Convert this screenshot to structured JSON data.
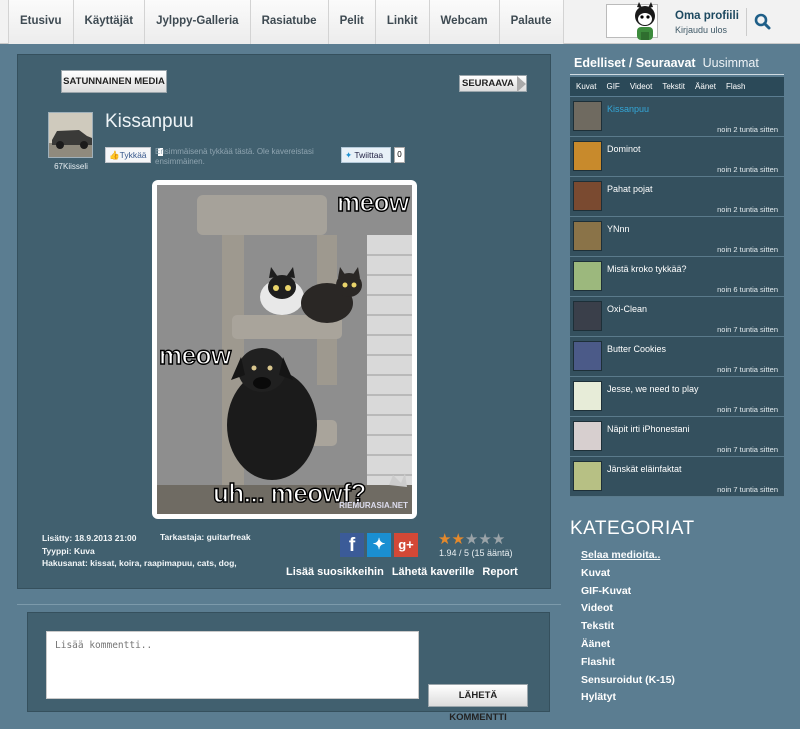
{
  "nav": {
    "tabs": [
      "Etusivu",
      "Käyttäjät",
      "Jylppy-Galleria",
      "Rasiatube",
      "Pelit",
      "Linkit",
      "Webcam",
      "Palaute"
    ]
  },
  "profile": {
    "name": "Oma profiili",
    "logout": "Kirjaudu ulos",
    "search_icon": "search-icon"
  },
  "media": {
    "random_button": "SATUNNAINEN MEDIA",
    "next_button": "SEURAAVA",
    "title": "Kissanpuu",
    "uploader": "67Kiisseli",
    "like_button": "Tykkää",
    "like_text": "Ensimmäisenä tykkää tästä. Ole kavereistasi ensimmäinen.",
    "tweet_button": "Twiittaa",
    "tweet_count": "0",
    "meme_text": {
      "top": "meow",
      "middle": "meow",
      "bottom": "uh... meowf?",
      "watermark": "RIEMURASIA.NET"
    },
    "added": "Lisätty: 18.9.2013 21:00",
    "reviewer": "Tarkastaja: guitarfreak",
    "type": "Tyyppi: Kuva",
    "tags": "Hakusanat: kissat, koira, raapimapuu, cats, dog,",
    "rating": {
      "value": 1.94,
      "max": 5,
      "text": "1.94 / 5 (15 ääntä)"
    },
    "actions": [
      "Lisää suosikkeihin",
      "Lähetä kaverille",
      "Report"
    ],
    "share_icons": [
      "facebook-icon",
      "twitter-icon",
      "googleplus-icon"
    ]
  },
  "comment": {
    "placeholder": "Lisää kommentti..",
    "send_button": "LÄHETÄ KOMMENTTI"
  },
  "sidebar": {
    "tabs_active": "Edelliset / Seuraavat",
    "tab_new": "Uusimmat",
    "types": [
      "Kuvat",
      "GIF",
      "Videot",
      "Tekstit",
      "Äänet",
      "Flash"
    ],
    "items": [
      {
        "title": "Kissanpuu",
        "time": "noin 2 tuntia sitten",
        "active": true,
        "color": "#6f6a60"
      },
      {
        "title": "Dominot",
        "time": "noin 2 tuntia sitten",
        "active": false,
        "color": "#c88a2c"
      },
      {
        "title": "Pahat pojat",
        "time": "noin 2 tuntia sitten",
        "active": false,
        "color": "#7a4a30"
      },
      {
        "title": "YNnn",
        "time": "noin 2 tuntia sitten",
        "active": false,
        "color": "#8a7348"
      },
      {
        "title": "Mistä kroko tykkää?",
        "time": "noin 6 tuntia sitten",
        "active": false,
        "color": "#9cb87d"
      },
      {
        "title": "Oxi-Clean",
        "time": "noin 7 tuntia sitten",
        "active": false,
        "color": "#3a3f4a"
      },
      {
        "title": "Butter Cookies",
        "time": "noin 7 tuntia sitten",
        "active": false,
        "color": "#4b5a88"
      },
      {
        "title": "Jesse, we need to play",
        "time": "noin 7 tuntia sitten",
        "active": false,
        "color": "#e7ecd8"
      },
      {
        "title": "Näpit irti iPhonestani",
        "time": "noin 7 tuntia sitten",
        "active": false,
        "color": "#d7cfcf"
      },
      {
        "title": "Jänskät eläinfaktat",
        "time": "noin 7 tuntia sitten",
        "active": false,
        "color": "#b7c084"
      }
    ],
    "categories_title": "KATEGORIAT",
    "categories": [
      "Selaa medioita..",
      "Kuvat",
      "GIF-Kuvat",
      "Videot",
      "Tekstit",
      "Äänet",
      "Flashit",
      "Sensuroidut (K-15)",
      "Hylätyt"
    ]
  },
  "colors": {
    "background": "#5b7d91",
    "panel": "#41606f",
    "active_link": "#33a7d8",
    "star_on": "#e4892c"
  }
}
